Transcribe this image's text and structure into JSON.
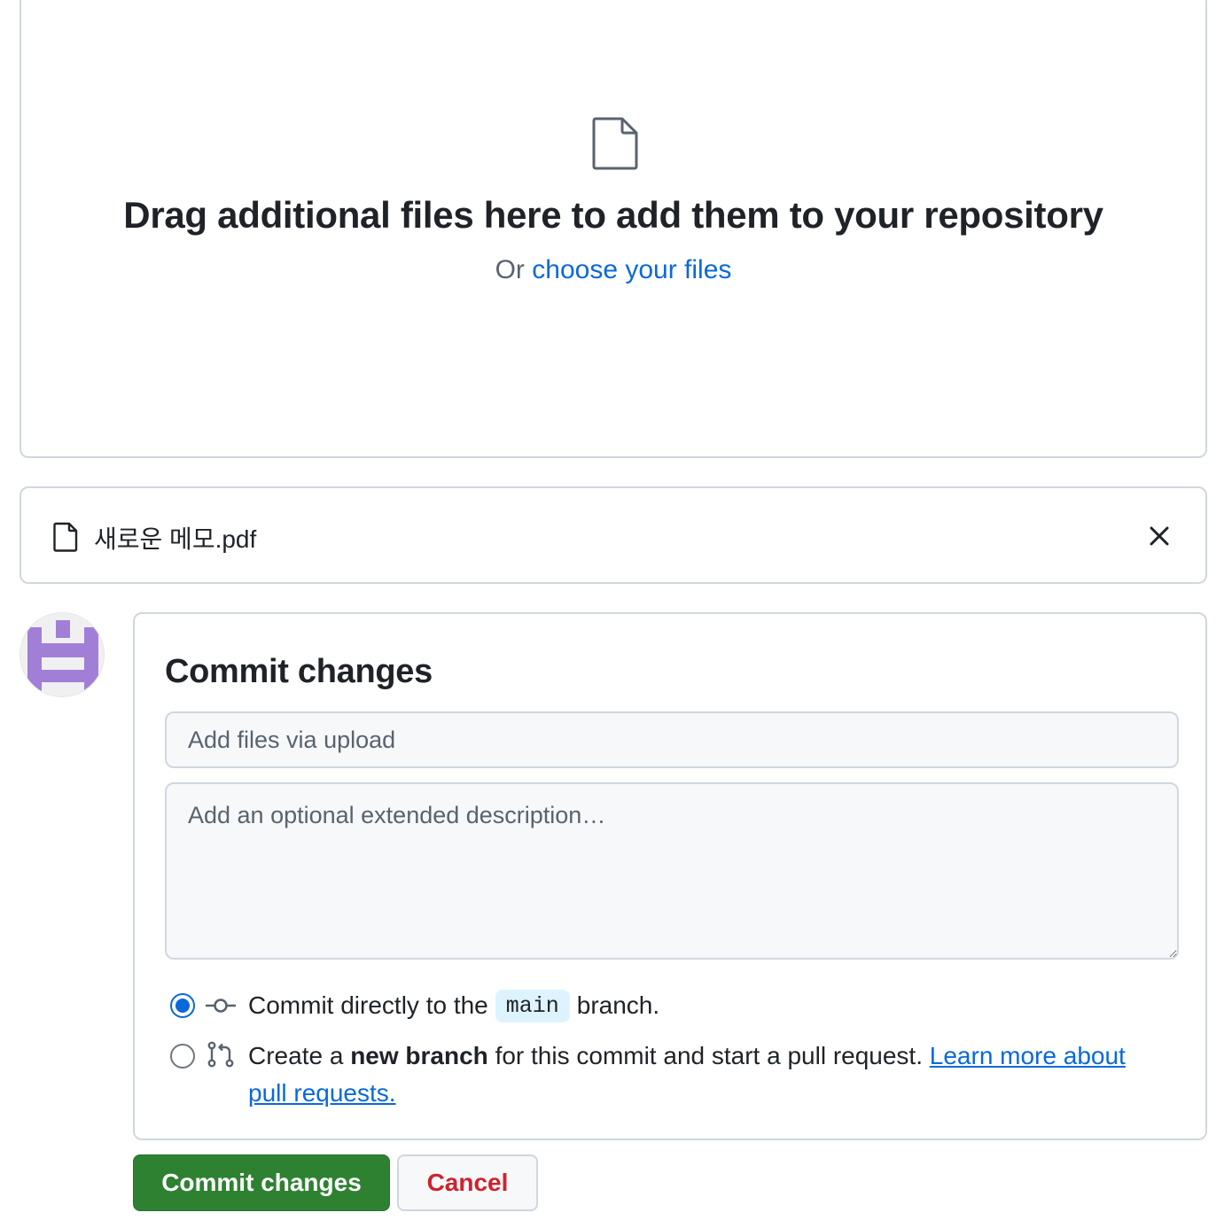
{
  "dropzone": {
    "icon": "file-icon",
    "title": "Drag additional files here to add them to your repository",
    "sub_prefix": "Or",
    "sub_link": "choose your files"
  },
  "file": {
    "icon": "file-icon",
    "name": "새로운 메모.pdf",
    "remove_icon": "close-icon"
  },
  "avatar": {
    "color": "#a27fd6"
  },
  "commit": {
    "title": "Commit changes",
    "summary_placeholder": "Add files via upload",
    "description_placeholder": "Add an optional extended description…",
    "options": {
      "direct": {
        "icon": "git-commit-icon",
        "prefix": "Commit directly to the",
        "branch": "main",
        "suffix": "branch.",
        "selected": true
      },
      "new_branch": {
        "icon": "git-pull-request-icon",
        "prefix": "Create a",
        "bold": "new branch",
        "suffix": "for this commit and start a pull request.",
        "link": "Learn more about pull requests.",
        "selected": false
      }
    }
  },
  "buttons": {
    "commit_label": "Commit changes",
    "cancel_label": "Cancel"
  },
  "colors": {
    "accent": "#0969da",
    "primary_button": "#2f8132",
    "danger_text": "#cf222e",
    "border": "#d0d7de"
  }
}
